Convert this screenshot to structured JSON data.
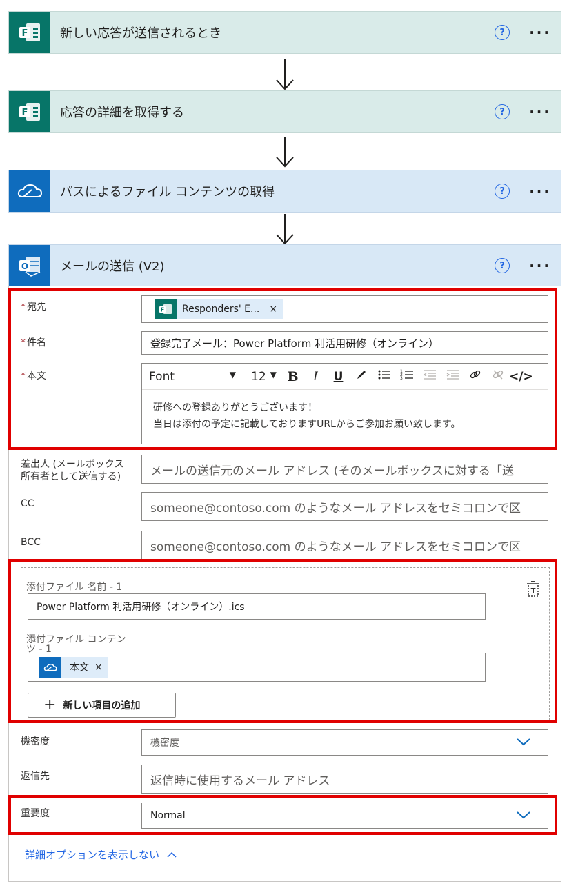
{
  "steps": [
    {
      "title": "新しい応答が送信されるとき",
      "icon": "forms-icon"
    },
    {
      "title": "応答の詳細を取得する",
      "icon": "forms-icon"
    },
    {
      "title": "パスによるファイル コンテンツの取得",
      "icon": "onedrive-icon"
    },
    {
      "title": "メールの送信 (V2)",
      "icon": "outlook-icon"
    }
  ],
  "help_glyph": "?",
  "more_glyph": "···",
  "fields": {
    "to_label": "宛先",
    "to_token": "Responders' E...",
    "token_remove": "×",
    "subject_label": "件名",
    "subject_value": "登録完了メール：Power Platform 利活用研修（オンライン）",
    "body_label": "本文",
    "required_mark": "*",
    "font_name": "Font",
    "font_size": "12",
    "body_lines": [
      "研修への登録ありがとうございます！",
      "当日は添付の予定に記載しておりますURLからご参加お願い致します。"
    ],
    "from_label_1": "差出人 (メールボックス",
    "from_label_2": "所有者として送信する)",
    "from_placeholder": "メールの送信元のメール アドレス (そのメールボックスに対する「送",
    "cc_label": "CC",
    "cc_placeholder": "someone@contoso.com のようなメール アドレスをセミコロンで区",
    "bcc_label": "BCC",
    "bcc_placeholder": "someone@contoso.com のようなメール アドレスをセミコロンで区",
    "attach_name_label": "添付ファイル 名前 - 1",
    "attach_name_value": "Power Platform 利活用研修（オンライン）.ics",
    "attach_content_label_1": "添付ファイル コンテン",
    "attach_content_label_2": "ツ - 1",
    "attach_token": "本文",
    "add_item": "新しい項目の追加",
    "sensitivity_label": "機密度",
    "sensitivity_value": "機密度",
    "reply_label": "返信先",
    "reply_placeholder": "返信時に使用するメール アドレス",
    "importance_label": "重要度",
    "importance_value": "Normal",
    "hide_options": "詳細オプションを表示しない"
  },
  "colors": {
    "forms": "#077568",
    "onedrive": "#0f6cbd",
    "outlook": "#0f6cbd",
    "highlight": "#e00000",
    "link": "#2266e3"
  }
}
